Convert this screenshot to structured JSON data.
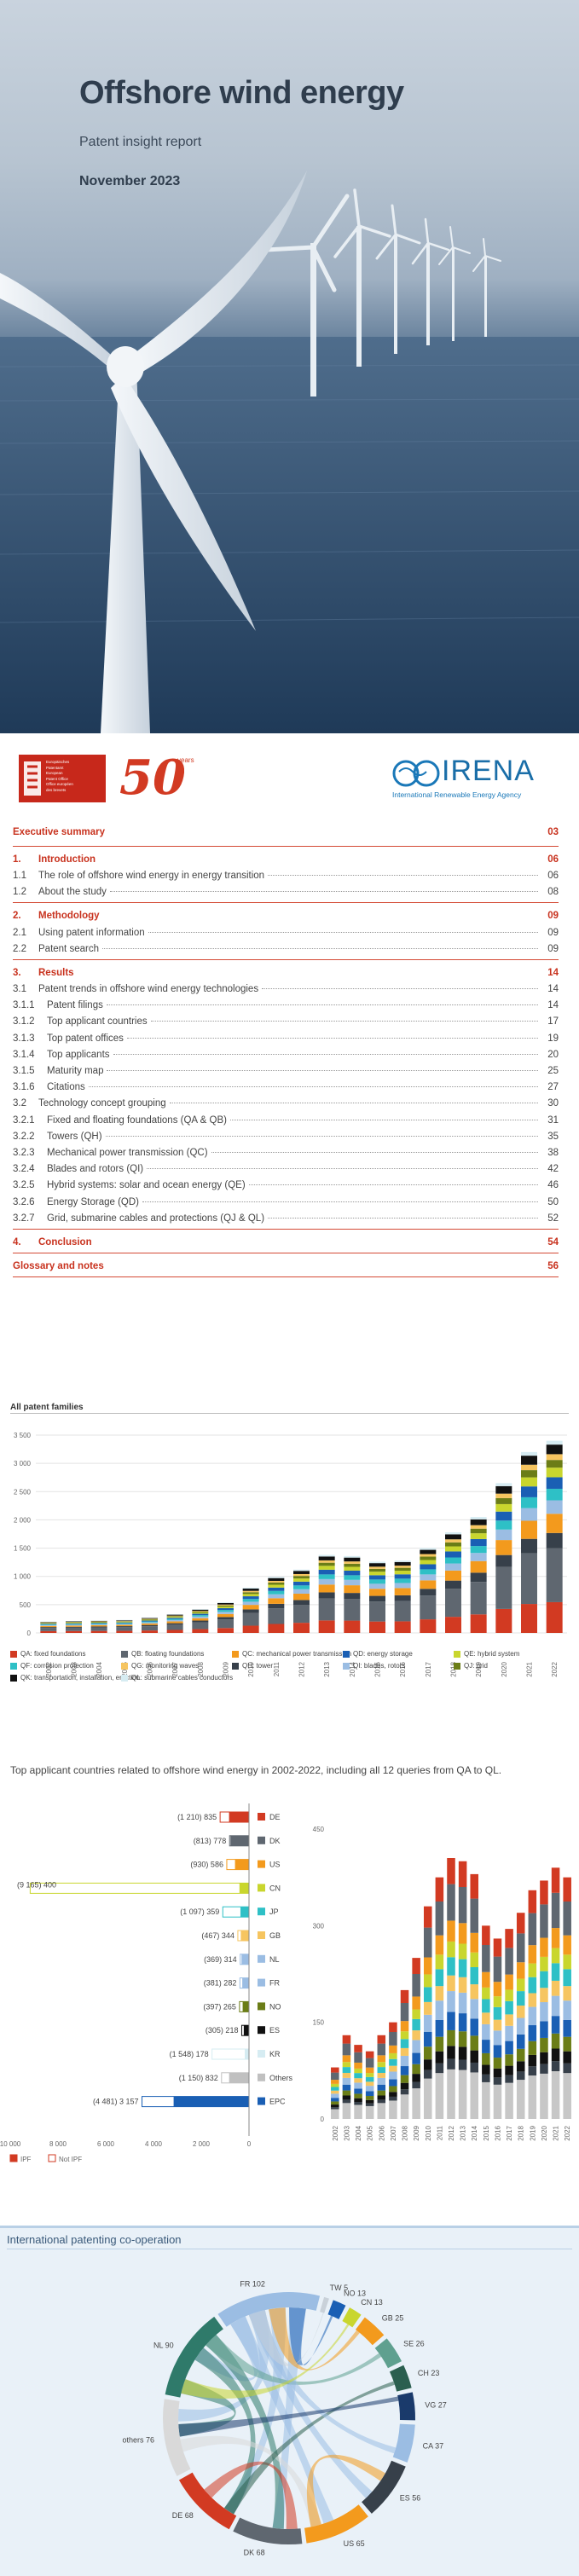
{
  "hero": {
    "title": "Offshore wind energy",
    "subtitle": "Patent insight report",
    "date": "November 2023"
  },
  "logos": {
    "epo_lines": [
      "Europäisches",
      "Patentamt",
      "European",
      "Patent Office",
      "Office européen",
      "des brevets"
    ],
    "anniversary_number": "50",
    "anniversary_word": "years",
    "irena_name": "IRENA",
    "irena_full": "International Renewable Energy Agency"
  },
  "toc": [
    {
      "num": "",
      "title": "Executive summary",
      "page": "03",
      "type": "sec"
    },
    {
      "num": "1.",
      "title": "Introduction",
      "page": "06",
      "type": "sec"
    },
    {
      "num": "1.1",
      "title": "The role of offshore wind energy in energy transition",
      "page": "06",
      "type": "item"
    },
    {
      "num": "1.2",
      "title": "About the study",
      "page": "08",
      "type": "item"
    },
    {
      "num": "2.",
      "title": "Methodology",
      "page": "09",
      "type": "sec"
    },
    {
      "num": "2.1",
      "title": "Using patent information",
      "page": "09",
      "type": "item"
    },
    {
      "num": "2.2",
      "title": "Patent search",
      "page": "09",
      "type": "item"
    },
    {
      "num": "3.",
      "title": "Results",
      "page": "14",
      "type": "sec"
    },
    {
      "num": "3.1",
      "title": "Patent trends in offshore wind energy technologies",
      "page": "14",
      "type": "item"
    },
    {
      "num": "3.1.1",
      "title": "Patent filings",
      "page": "14",
      "type": "item"
    },
    {
      "num": "3.1.2",
      "title": "Top applicant countries",
      "page": "17",
      "type": "item"
    },
    {
      "num": "3.1.3",
      "title": "Top patent offices",
      "page": "19",
      "type": "item"
    },
    {
      "num": "3.1.4",
      "title": "Top applicants",
      "page": "20",
      "type": "item"
    },
    {
      "num": "3.1.5",
      "title": "Maturity map",
      "page": "25",
      "type": "item"
    },
    {
      "num": "3.1.6",
      "title": "Citations",
      "page": "27",
      "type": "item"
    },
    {
      "num": "3.2",
      "title": "Technology concept grouping",
      "page": "30",
      "type": "item"
    },
    {
      "num": "3.2.1",
      "title": "Fixed and floating foundations (QA & QB)",
      "page": "31",
      "type": "item"
    },
    {
      "num": "3.2.2",
      "title": "Towers (QH)",
      "page": "35",
      "type": "item"
    },
    {
      "num": "3.2.3",
      "title": "Mechanical power transmission (QC)",
      "page": "38",
      "type": "item"
    },
    {
      "num": "3.2.4",
      "title": "Blades and rotors (QI)",
      "page": "42",
      "type": "item"
    },
    {
      "num": "3.2.5",
      "title": "Hybrid systems: solar and ocean energy (QE)",
      "page": "46",
      "type": "item"
    },
    {
      "num": "3.2.6",
      "title": "Energy Storage (QD)",
      "page": "50",
      "type": "item"
    },
    {
      "num": "3.2.7",
      "title": "Grid, submarine cables and protections (QJ & QL)",
      "page": "52",
      "type": "item"
    },
    {
      "num": "4.",
      "title": "Conclusion",
      "page": "54",
      "type": "sec"
    },
    {
      "num": "",
      "title": "Glossary and notes",
      "page": "56",
      "type": "sec"
    }
  ],
  "colors": {
    "accent": "#c8321e",
    "qa": "#d23a22",
    "qb": "#5f6770",
    "qc": "#f39a1d",
    "qd": "#1a5fb4",
    "qe": "#c9d62e",
    "qf": "#2ec0c6",
    "qg": "#f6c560",
    "qh": "#37404a",
    "qi": "#9bbde3",
    "qj": "#6b7d17",
    "qk": "#111111",
    "ql": "#d6ecf2"
  },
  "chart_data": [
    {
      "type": "bar",
      "title": "All patent families",
      "ylim": [
        0,
        3500
      ],
      "yticks": [
        "0",
        "500",
        "1 000",
        "1 500",
        "2 000",
        "2 500",
        "3 000",
        "3 500"
      ],
      "categories": [
        "2002",
        "2003",
        "2004",
        "2005",
        "2006",
        "2007",
        "2008",
        "2009",
        "2010",
        "2011",
        "2012",
        "2013",
        "2014",
        "2015",
        "2016",
        "2017",
        "2018",
        "2019",
        "2020",
        "2021",
        "2022"
      ],
      "totals": [
        200,
        210,
        220,
        230,
        270,
        330,
        420,
        540,
        800,
        990,
        1120,
        1380,
        1360,
        1260,
        1280,
        1500,
        1780,
        2050,
        2650,
        3200,
        3400
      ],
      "legend": [
        {
          "code": "qa",
          "label": "QA: fixed foundations"
        },
        {
          "code": "qb",
          "label": "QB: floating foundations"
        },
        {
          "code": "qc",
          "label": "QC: mechanical power transmission"
        },
        {
          "code": "qd",
          "label": "QD: energy storage"
        },
        {
          "code": "qe",
          "label": "QE: hybrid system"
        },
        {
          "code": "qf",
          "label": "QF: corrosion protection"
        },
        {
          "code": "qg",
          "label": "QG: monitoring waves"
        },
        {
          "code": "qh",
          "label": "QH: tower"
        },
        {
          "code": "qi",
          "label": "QI: blades, rotors"
        },
        {
          "code": "qj",
          "label": "QJ: grid"
        },
        {
          "code": "qk",
          "label": "QK: transportation, installation, erection"
        },
        {
          "code": "ql",
          "label": "QL: submarine cables conductors"
        }
      ]
    },
    {
      "type": "bar",
      "title": "Top applicant countries related to offshore wind energy in 2002-2022, including all 12 queries from QA to QL.",
      "countries": [
        {
          "code": "DE",
          "ipf": 835,
          "non_ipf": 1210,
          "label": "(1 210) 835"
        },
        {
          "code": "DK",
          "ipf": 778,
          "non_ipf": 813,
          "label": "(813) 778"
        },
        {
          "code": "US",
          "ipf": 586,
          "non_ipf": 930,
          "label": "(930) 586"
        },
        {
          "code": "CN",
          "ipf": 400,
          "non_ipf": 9165,
          "label": "(9 165) 400"
        },
        {
          "code": "JP",
          "ipf": 359,
          "non_ipf": 1097,
          "label": "(1 097) 359"
        },
        {
          "code": "GB",
          "ipf": 344,
          "non_ipf": 467,
          "label": "(467) 344"
        },
        {
          "code": "NL",
          "ipf": 314,
          "non_ipf": 369,
          "label": "(369) 314"
        },
        {
          "code": "FR",
          "ipf": 282,
          "non_ipf": 381,
          "label": "(381) 282"
        },
        {
          "code": "NO",
          "ipf": 265,
          "non_ipf": 397,
          "label": "(397) 265"
        },
        {
          "code": "ES",
          "ipf": 218,
          "non_ipf": 305,
          "label": "(305) 218"
        },
        {
          "code": "KR",
          "ipf": 178,
          "non_ipf": 1548,
          "label": "(1 548) 178"
        },
        {
          "code": "Others",
          "ipf": 832,
          "non_ipf": 1150,
          "label": "(1 150) 832"
        },
        {
          "code": "EPC",
          "ipf": 3157,
          "non_ipf": 4481,
          "label": "(4 481) 3 157"
        }
      ],
      "xticks": [
        "10 000",
        "8 000",
        "6 000",
        "4 000",
        "2 000",
        "0"
      ],
      "legend": [
        "IPF",
        "Not IPF"
      ],
      "stack_yticks": [
        "0",
        "150",
        "300",
        "450"
      ],
      "stack_years": [
        "2002",
        "2003",
        "2004",
        "2005",
        "2006",
        "2007",
        "2008",
        "2009",
        "2010",
        "2011",
        "2012",
        "2013",
        "2014",
        "2015",
        "2016",
        "2017",
        "2018",
        "2019",
        "2020",
        "2021",
        "2022"
      ],
      "stack_totals": [
        80,
        130,
        115,
        105,
        130,
        150,
        200,
        250,
        330,
        375,
        405,
        400,
        380,
        300,
        280,
        295,
        320,
        355,
        370,
        390,
        375
      ]
    },
    {
      "type": "chord",
      "title": "International patenting co-operation",
      "nodes": [
        {
          "name": "FR",
          "value": 102,
          "label": "FR 102"
        },
        {
          "name": "TW",
          "value": 5,
          "label": "TW 5"
        },
        {
          "name": "NO",
          "value": 13,
          "label": "NO 13"
        },
        {
          "name": "CN",
          "value": 13,
          "label": "CN 13"
        },
        {
          "name": "GB",
          "value": 25,
          "label": "GB 25"
        },
        {
          "name": "SE",
          "value": 26,
          "label": "SE 26"
        },
        {
          "name": "CH",
          "value": 23,
          "label": "CH 23"
        },
        {
          "name": "VG",
          "value": 27,
          "label": "VG 27"
        },
        {
          "name": "CA",
          "value": 37,
          "label": "CA 37"
        },
        {
          "name": "ES",
          "value": 56,
          "label": "ES 56"
        },
        {
          "name": "US",
          "value": 65,
          "label": "US 65"
        },
        {
          "name": "DK",
          "value": 68,
          "label": "DK 68"
        },
        {
          "name": "DE",
          "value": 68,
          "label": "DE 68"
        },
        {
          "name": "others",
          "value": 76,
          "label": "others 76"
        },
        {
          "name": "NL",
          "value": 90,
          "label": "NL 90"
        }
      ]
    }
  ]
}
